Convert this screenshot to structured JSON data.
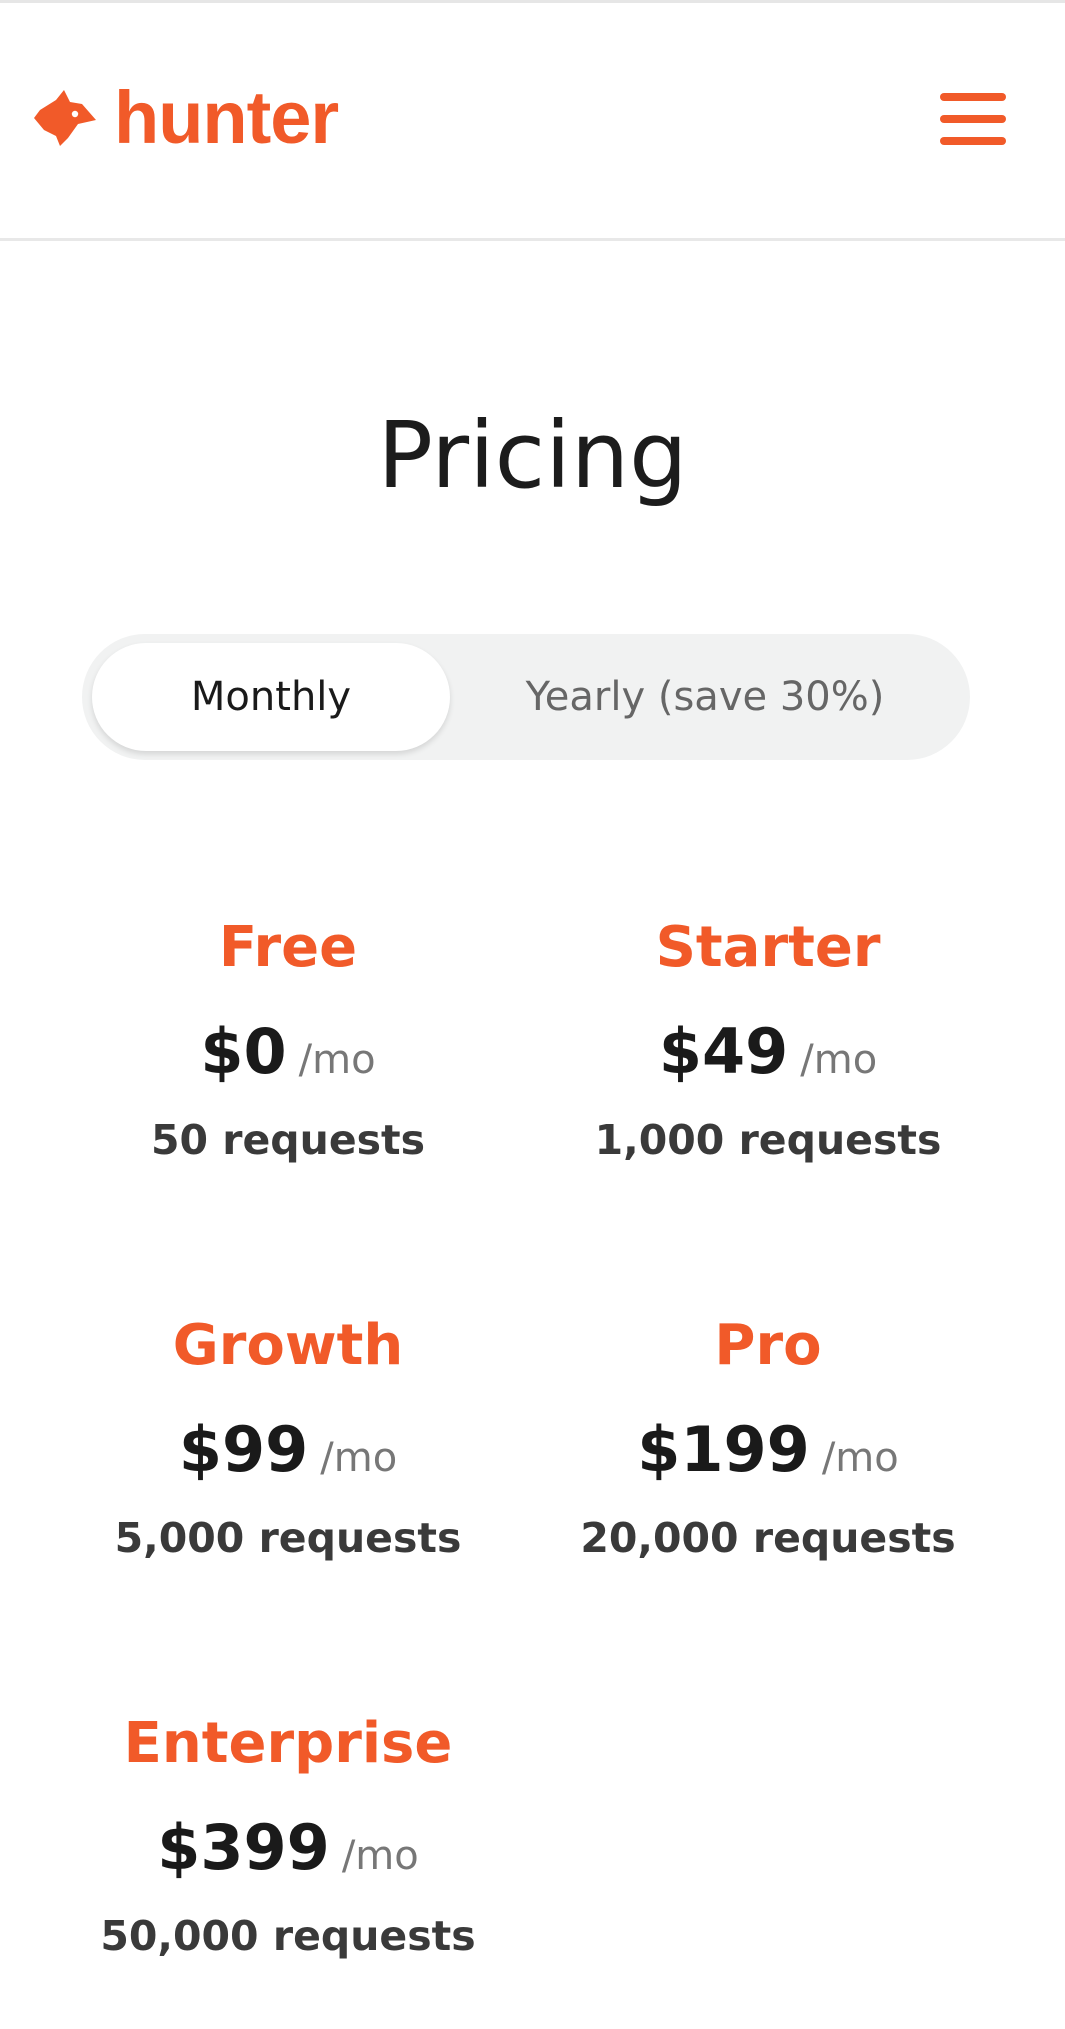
{
  "brand": {
    "name": "hunter",
    "accent_color": "#f15a29",
    "icon": "fox-head-icon"
  },
  "header": {
    "menu_icon": "hamburger-menu-icon"
  },
  "page": {
    "title": "Pricing"
  },
  "billing_toggle": {
    "monthly_label": "Monthly",
    "yearly_label": "Yearly (save 30%)",
    "selected": "Monthly"
  },
  "plans": [
    {
      "name": "Free",
      "price": "$0",
      "period": "/mo",
      "requests": "50 requests"
    },
    {
      "name": "Starter",
      "price": "$49",
      "period": "/mo",
      "requests": "1,000 requests"
    },
    {
      "name": "Growth",
      "price": "$99",
      "period": "/mo",
      "requests": "5,000 requests"
    },
    {
      "name": "Pro",
      "price": "$199",
      "period": "/mo",
      "requests": "20,000 requests"
    },
    {
      "name": "Enterprise",
      "price": "$399",
      "period": "/mo",
      "requests": "50,000 requests"
    }
  ]
}
